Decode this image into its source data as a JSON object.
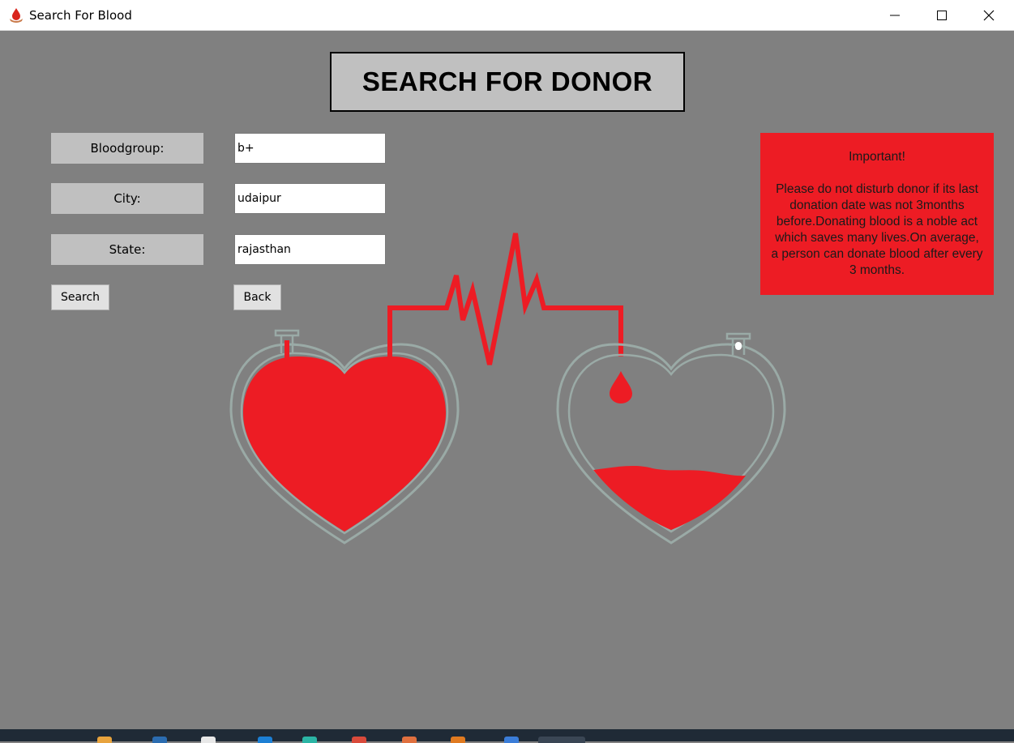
{
  "window": {
    "title": "Search For Blood",
    "controls": [
      "minimize-icon",
      "maximize-icon",
      "close-icon"
    ]
  },
  "page": {
    "heading": "SEARCH FOR DONOR"
  },
  "form": {
    "bloodgroup": {
      "label": "Bloodgroup:",
      "value": "b+"
    },
    "city": {
      "label": "City:",
      "value": "udaipur"
    },
    "state": {
      "label": "State:",
      "value": "rajasthan"
    }
  },
  "buttons": {
    "search": "Search",
    "back": "Back"
  },
  "notice": {
    "heading": "Important!",
    "body": "Please do not disturb donor if its last donation date was not 3months before.Donating blood is a noble act which saves many lives.On average, a person can donate blood after every 3 months."
  },
  "colors": {
    "background": "#808080",
    "blood_red": "#ed1c24",
    "label_grey": "#c0c0c0",
    "heart_outline": "#9aaaa6"
  }
}
